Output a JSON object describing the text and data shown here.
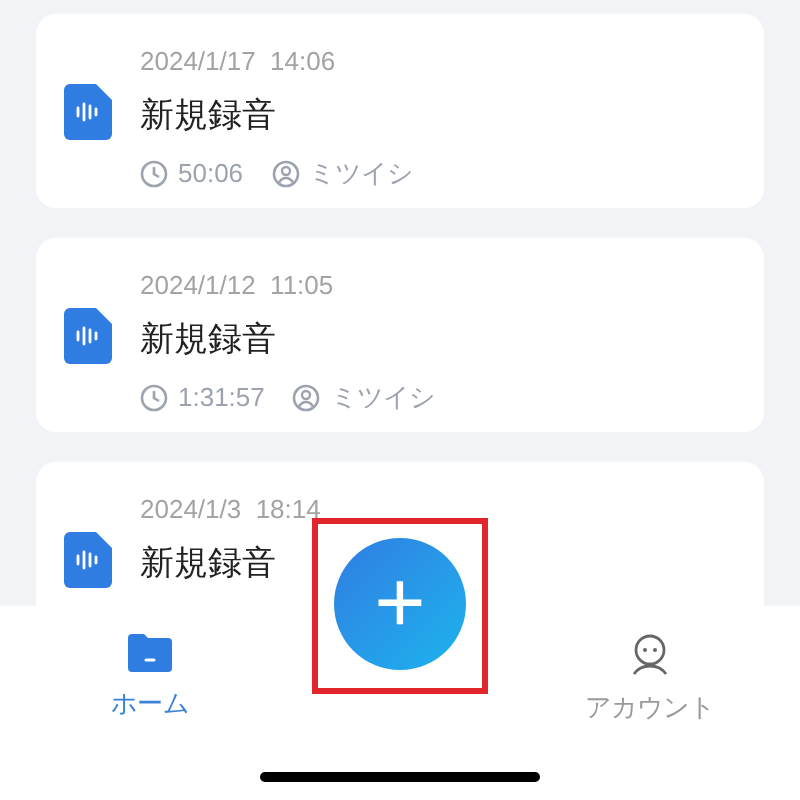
{
  "recordings": [
    {
      "date": "2024/1/17  14:06",
      "title": "新規録音",
      "duration": "50:06",
      "user": "ミツイシ"
    },
    {
      "date": "2024/1/12  11:05",
      "title": "新規録音",
      "duration": "1:31:57",
      "user": "ミツイシ"
    },
    {
      "date": "2024/1/3  18:14",
      "title": "新規録音"
    }
  ],
  "fab": {
    "label": "+",
    "highlighted": true
  },
  "tabs": [
    {
      "label": "ホーム",
      "selected": true,
      "kind": "home"
    },
    {
      "label": "アカウント",
      "selected": false,
      "kind": "account"
    }
  ]
}
